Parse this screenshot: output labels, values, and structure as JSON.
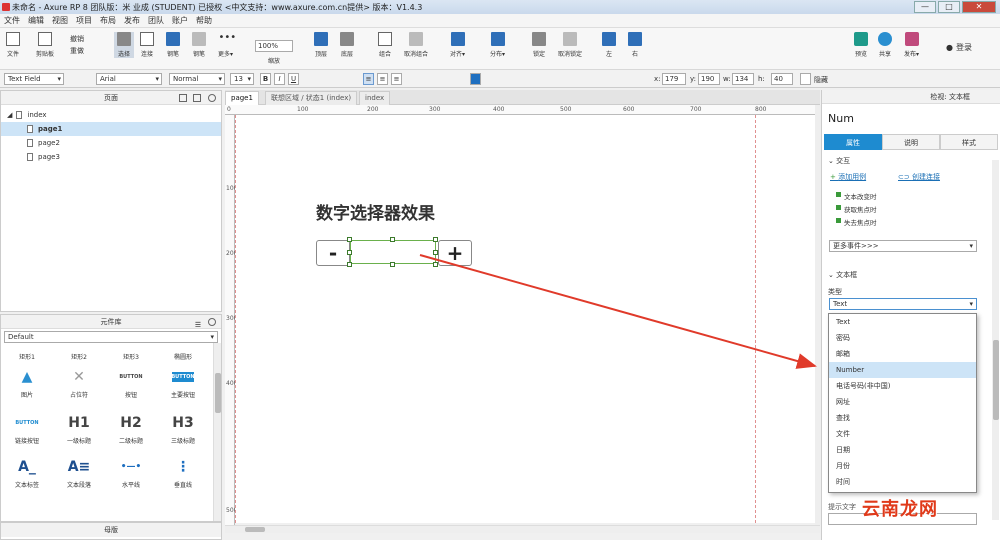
{
  "titlebar": {
    "text": "未命名 - Axure RP 8 团队版：米 业成 (STUDENT) 已授权    <中文支持：www.axure.com.cn提供> 版本：V1.4.3",
    "min": "—",
    "max": "□",
    "close": "✕"
  },
  "menu": [
    "文件",
    "编辑",
    "视图",
    "项目",
    "布局",
    "发布",
    "团队",
    "账户",
    "帮助"
  ],
  "toolbar": {
    "file": "文件",
    "clipboard": "剪贴板",
    "cut": "✂",
    "undo": "撤销",
    "redo": "重做",
    "select": "选择",
    "connect": "连接",
    "pen": "钢笔",
    "more": "更多▾",
    "zoom_value": "100%",
    "zoom_label": "缩放",
    "top": "顶层",
    "bottom": "底层",
    "group": "组合",
    "ungroup": "取消组合",
    "align": "对齐▾",
    "distribute": "分布▾",
    "lock": "锁定",
    "unlock": "取消锁定",
    "left": "左",
    "right": "右",
    "preview": "预览",
    "share": "共享",
    "publish": "发布▾",
    "login": "登录"
  },
  "format": {
    "widget_type": "Text Field",
    "font": "Arial",
    "style": "Normal",
    "size": "13",
    "bold": "B",
    "italic": "I",
    "underline": "U",
    "x_label": "x:",
    "x": "179",
    "y_label": "y:",
    "y": "190",
    "w_label": "w:",
    "w": "134",
    "h_label": "h:",
    "h": "40",
    "hidden_label": "隐藏"
  },
  "pages_panel": {
    "title": "页面",
    "root": "index",
    "items": [
      "page1",
      "page2",
      "page3"
    ]
  },
  "library_panel": {
    "title": "元件库",
    "selected": "Default",
    "widgets": [
      {
        "label": "矩形1",
        "glyph": ""
      },
      {
        "label": "矩形2",
        "glyph": ""
      },
      {
        "label": "矩形3",
        "glyph": ""
      },
      {
        "label": "椭圆形",
        "glyph": ""
      },
      {
        "label": "图片",
        "glyph": "▲"
      },
      {
        "label": "占位符",
        "glyph": "✕"
      },
      {
        "label": "按钮",
        "glyph": "BUTTON"
      },
      {
        "label": "主要按钮",
        "glyph": "BUTTON"
      },
      {
        "label": "链接按钮",
        "glyph": "BUTTON"
      },
      {
        "label": "一级标题",
        "glyph": "H1"
      },
      {
        "label": "二级标题",
        "glyph": "H2"
      },
      {
        "label": "三级标题",
        "glyph": "H3"
      },
      {
        "label": "文本标签",
        "glyph": "A_"
      },
      {
        "label": "文本段落",
        "glyph": "A≡"
      },
      {
        "label": "水平线",
        "glyph": "•—•"
      },
      {
        "label": "垂直线",
        "glyph": "⋮"
      }
    ]
  },
  "masters_panel": {
    "title": "母版"
  },
  "tabs": [
    "page1",
    "联想区域 / 状态1 (index)",
    "index"
  ],
  "ruler": {
    "h": [
      "0",
      "100",
      "200",
      "300",
      "400",
      "500",
      "600",
      "700",
      "800"
    ],
    "v": [
      "100",
      "200",
      "300",
      "400",
      "500"
    ]
  },
  "canvas": {
    "heading": "数字选择器效果",
    "minus": "-",
    "plus": "+"
  },
  "inspector": {
    "title": "检视: 文本框",
    "name": "Num",
    "tabs": [
      "属性",
      "说明",
      "样式"
    ],
    "interaction_title": "交互",
    "add_case": "添加用例",
    "create_link": "创建连接",
    "events": [
      "文本改变时",
      "获取焦点时",
      "失去焦点时"
    ],
    "more_events": "更多事件>>>",
    "textbox_title": "文本框",
    "type_label": "类型",
    "type_value": "Text",
    "options": [
      "Text",
      "密码",
      "邮箱",
      "Number",
      "电话号码(非中国)",
      "网址",
      "查找",
      "文件",
      "日期",
      "月份",
      "时间"
    ],
    "selected_option": "Number",
    "bottom_label": "提示文字"
  },
  "watermark": "云南龙网",
  "colors": {
    "accent": "#1e8bd0",
    "selection_green": "#6ab04c",
    "arrow_red": "#e03a2a"
  }
}
